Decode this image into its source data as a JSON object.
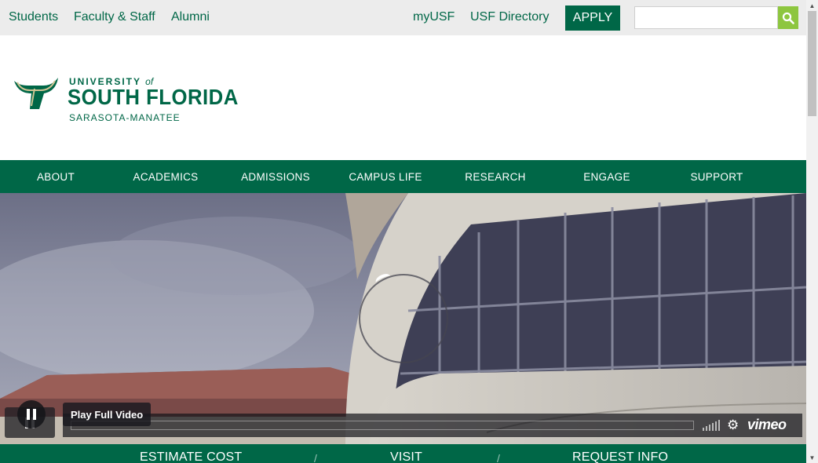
{
  "topbar": {
    "links_left": [
      "Students",
      "Faculty & Staff",
      "Alumni"
    ],
    "links_right": [
      "myUSF",
      "USF Directory"
    ],
    "apply_label": "APPLY",
    "search": {
      "value": "",
      "placeholder": ""
    }
  },
  "logo": {
    "line1": "UNIVERSITY",
    "line1_of": "of",
    "line2": "SOUTH FLORIDA",
    "line3": "SARASOTA-MANATEE"
  },
  "nav": {
    "items": [
      "ABOUT",
      "ACADEMICS",
      "ADMISSIONS",
      "CAMPUS LIFE",
      "RESEARCH",
      "ENGAGE",
      "SUPPORT"
    ]
  },
  "video": {
    "play_full_label": "Play Full Video",
    "brand": "vimeo",
    "icons": [
      "pause-icon",
      "volume-icon",
      "settings-gear-icon"
    ]
  },
  "cta": {
    "items": [
      "ESTIMATE COST",
      "VISIT",
      "REQUEST INFO"
    ]
  },
  "colors": {
    "primary_green": "#006747",
    "accent_green": "#8dc63f",
    "topbar_bg": "#ececec"
  }
}
